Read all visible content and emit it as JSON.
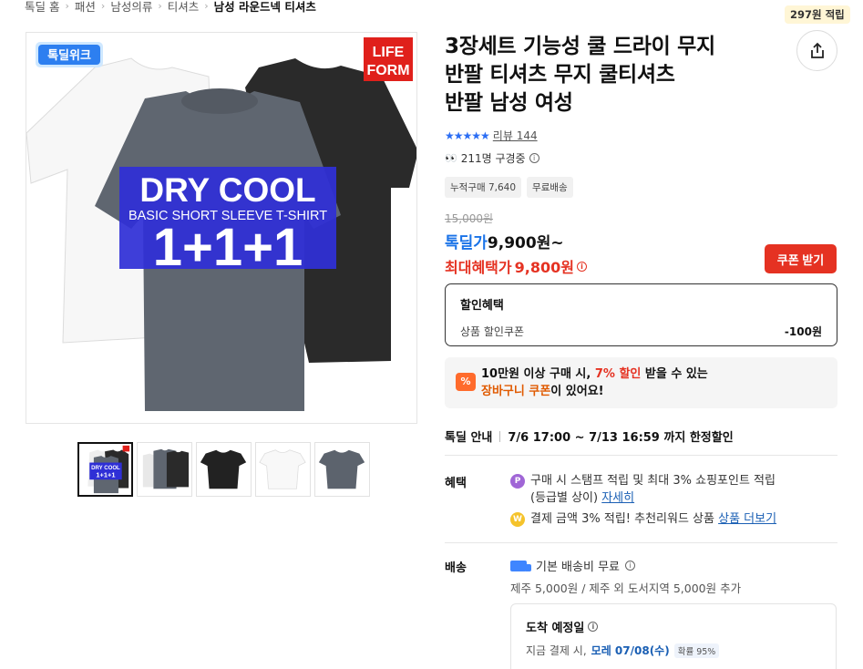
{
  "breadcrumb": {
    "items": [
      "톡딜 홈",
      "패션",
      "남성의류",
      "티셔츠",
      "남성 라운드넥 티셔츠"
    ]
  },
  "points_badge": "297원 적립",
  "main_image": {
    "badge_left": "톡딜위크",
    "badge_right_line1": "LIFE",
    "badge_right_line2": "FORM",
    "banner_line1": "DRY COOL",
    "banner_line2": "BASIC SHORT SLEEVE T-SHIRT",
    "banner_line3": "1+1+1"
  },
  "thumbnails": {
    "first_line1": "DRY COOL",
    "first_line2": "1+1+1"
  },
  "product": {
    "title_line1": "3장세트 기능성 쿨 드라이 무지",
    "title_line2": "반팔 티셔츠 무지 쿨티셔츠",
    "title_line3": "반팔 남성 여성",
    "stars": "★★★★★",
    "review_label": "리뷰 144",
    "viewers_eyes": "👀",
    "viewers": "211명 구경중",
    "tags": [
      "누적구매 7,640",
      "무료배송"
    ],
    "original_price": "15,000원",
    "deal_label": "톡딜가",
    "deal_price": "9,900원~",
    "max_label": "최대혜택가",
    "max_price": "9,800원",
    "coupon_button": "쿠폰 받기"
  },
  "discount": {
    "heading": "할인혜택",
    "row_label": "상품 할인쿠폰",
    "row_value": "-100원"
  },
  "promo": {
    "icon": "%",
    "text_a": "10만원 이상 구매 시, ",
    "text_hl": "7% 할인",
    "text_b": " 받을 수 있는",
    "text_hl2": "장바구니 쿠폰",
    "text_c": "이 있어요!"
  },
  "deal_info": {
    "label": "톡딜 안내",
    "value": "7/6 17:00 ~ 7/13 16:59 까지 한정할인"
  },
  "benefits": {
    "label": "혜택",
    "row1_icon": "P",
    "row1_text": "구매 시 스탬프 적립 및 최대 3% 쇼핑포인트 적립",
    "row1_text2": "(등급별 상이) ",
    "row1_link": "자세히",
    "row2_icon": "W",
    "row2_text": "결제 금액 3% 적립! 추천리워드 상품 ",
    "row2_link": "상품 더보기"
  },
  "shipping": {
    "label": "배송",
    "main": "기본 배송비 무료",
    "sub": "제주 5,000원 / 제주 외 도서지역 5,000원 추가",
    "arrival_heading": "도착 예정일",
    "arrival_prefix": "지금 결제 시,",
    "arrival_date": "모레 07/08(수)",
    "arrival_prob": "확률 95%"
  },
  "colors": {
    "accent_red": "#e53222",
    "accent_blue": "#1a73e8",
    "banner_blue": "#2f2fd6"
  }
}
